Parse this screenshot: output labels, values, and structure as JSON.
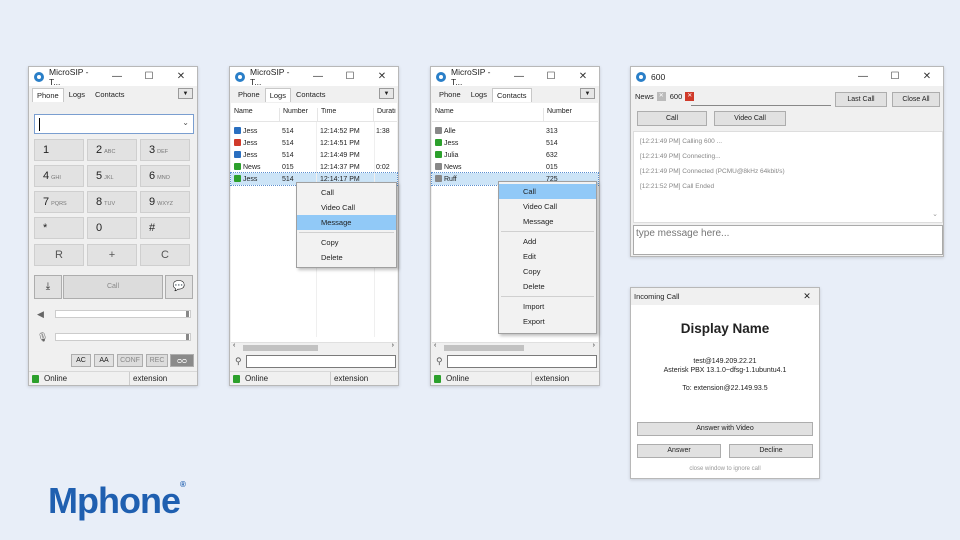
{
  "phone": {
    "title": "MicroSIP - T...",
    "tabs": [
      "Phone",
      "Logs",
      "Contacts"
    ],
    "keys": [
      {
        "main": "1",
        "sub": ""
      },
      {
        "main": "2",
        "sub": "ABC"
      },
      {
        "main": "3",
        "sub": "DEF"
      },
      {
        "main": "4",
        "sub": "GHI"
      },
      {
        "main": "5",
        "sub": "JKL"
      },
      {
        "main": "6",
        "sub": "MNO"
      },
      {
        "main": "7",
        "sub": "PQRS"
      },
      {
        "main": "8",
        "sub": "TUV"
      },
      {
        "main": "9",
        "sub": "WXYZ"
      },
      {
        "main": "*",
        "sub": ""
      },
      {
        "main": "0",
        "sub": ""
      },
      {
        "main": "#",
        "sub": ""
      }
    ],
    "ctrl_keys": [
      "R",
      "+",
      "C"
    ],
    "call_label": "Call",
    "bottom_buttons": [
      "AC",
      "AA",
      "CONF",
      "REC"
    ],
    "status": "Online",
    "extension": "extension"
  },
  "logs": {
    "title": "MicroSIP - T...",
    "tabs": [
      "Phone",
      "Logs",
      "Contacts"
    ],
    "columns": [
      "Name",
      "Number",
      "Time",
      "Durati"
    ],
    "rows": [
      {
        "name": "Jess",
        "number": "514",
        "time": "12:14:52 PM",
        "duration": "1:38",
        "color": "#2a6fc0"
      },
      {
        "name": "Jess",
        "number": "514",
        "time": "12:14:51 PM",
        "duration": "",
        "color": "#d03a2a"
      },
      {
        "name": "Jess",
        "number": "514",
        "time": "12:14:49 PM",
        "duration": "",
        "color": "#2a6fc0"
      },
      {
        "name": "News",
        "number": "015",
        "time": "12:14:37 PM",
        "duration": "0:02",
        "color": "#2ca02c"
      },
      {
        "name": "Jess",
        "number": "514",
        "time": "12:14:17 PM",
        "duration": "",
        "color": "#2ca02c"
      }
    ],
    "menu": [
      "Call",
      "Video Call",
      "Message",
      "Copy",
      "Delete"
    ],
    "status": "Online",
    "extension": "extension"
  },
  "contacts": {
    "title": "MicroSIP - T...",
    "tabs": [
      "Phone",
      "Logs",
      "Contacts"
    ],
    "columns": [
      "Name",
      "Number"
    ],
    "rows": [
      {
        "name": "Alle",
        "number": "313",
        "color": "#888888"
      },
      {
        "name": "Jess",
        "number": "514",
        "color": "#2ca02c"
      },
      {
        "name": "Julia",
        "number": "632",
        "color": "#2ca02c"
      },
      {
        "name": "News",
        "number": "015",
        "color": "#888888"
      },
      {
        "name": "Ruff",
        "number": "725",
        "color": "#888888"
      }
    ],
    "menu": [
      "Call",
      "Video Call",
      "Message",
      "Add",
      "Edit",
      "Copy",
      "Delete",
      "Import",
      "Export"
    ],
    "status": "Online",
    "extension": "extension"
  },
  "chat": {
    "title": "600",
    "tab_news": "News",
    "tab_600": "600",
    "last_call": "Last Call",
    "close_all": "Close All",
    "call": "Call",
    "video_call": "Video Call",
    "log": [
      "[12:21:49 PM]  Calling 600 ...",
      "[12:21:49 PM]  Connecting...",
      "[12:21:49 PM]  Connected (PCMU@8kHz 64kbit/s)",
      "[12:21:52 PM]  Call Ended"
    ],
    "message_placeholder": "type message here..."
  },
  "incoming": {
    "title": "Incoming Call",
    "display_name": "Display Name",
    "address": "test@149.209.22.21",
    "agent": "Asterisk PBX 13.1.0~dfsg-1.1ubuntu4.1",
    "to": "To: extension@22.149.93.5",
    "answer_video": "Answer with Video",
    "answer": "Answer",
    "decline": "Decline",
    "hint": "close window to ignore call"
  },
  "brand": {
    "logo": "Mphone",
    "mark": "®",
    "color": "#1f5fb0"
  }
}
